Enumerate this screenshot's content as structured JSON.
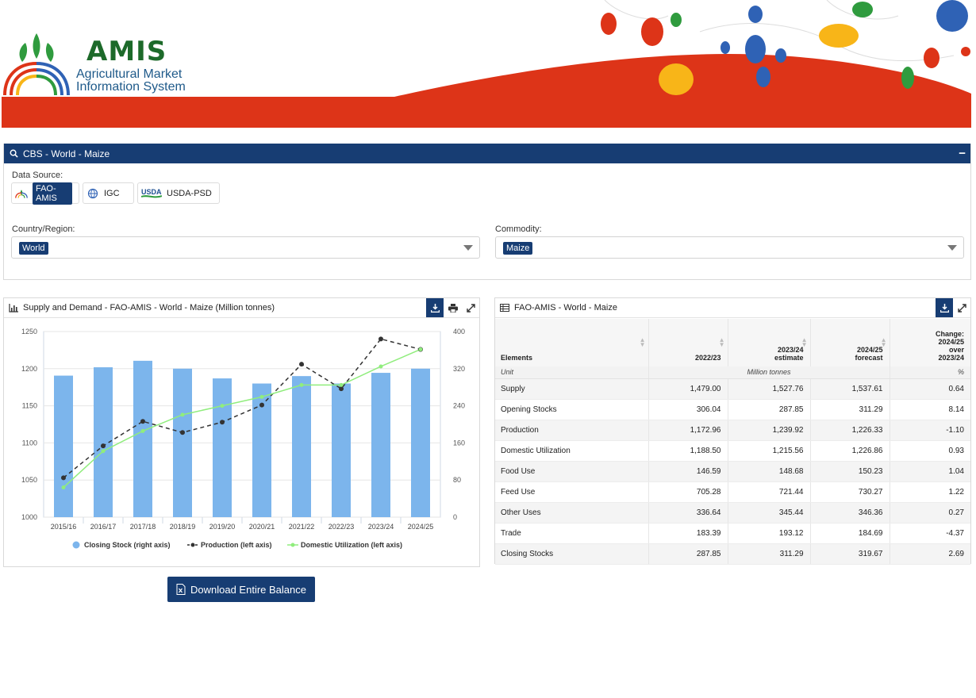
{
  "brand": {
    "name": "AMIS",
    "subtitle_line1": "Agricultural Market",
    "subtitle_line2": "Information System"
  },
  "cbs_panel": {
    "title": "CBS - World - Maize",
    "collapse_icon": "minus-icon",
    "data_source_label": "Data Source:",
    "data_sources": [
      {
        "label": "FAO-AMIS",
        "selected": true
      },
      {
        "label": "IGC",
        "selected": false
      },
      {
        "label": "USDA-PSD",
        "selected": false
      }
    ],
    "country_label": "Country/Region:",
    "country_value": "World",
    "commodity_label": "Commodity:",
    "commodity_value": "Maize"
  },
  "chart_panel": {
    "title": "Supply and Demand - FAO-AMIS - World - Maize (Million tonnes)",
    "tools": [
      "download-icon",
      "print-icon",
      "expand-icon"
    ]
  },
  "chart_data": {
    "type": "bar",
    "categories": [
      "2015/16",
      "2016/17",
      "2017/18",
      "2018/19",
      "2019/20",
      "2020/21",
      "2021/22",
      "2022/23",
      "2023/24",
      "2024/25"
    ],
    "left_axis": {
      "ylim": [
        1000,
        1250
      ],
      "ticks": [
        "1000",
        "1050",
        "1100",
        "1150",
        "1200",
        "1250"
      ]
    },
    "right_axis": {
      "ylim": [
        0,
        400
      ],
      "ticks": [
        "0",
        "80",
        "160",
        "240",
        "320",
        "400"
      ]
    },
    "series": [
      {
        "name": "Closing Stock (right axis)",
        "type": "bar",
        "axis": "right",
        "color": "#7cb5ec",
        "values": [
          305,
          323,
          337,
          320,
          299,
          288,
          304,
          288,
          311,
          320
        ]
      },
      {
        "name": "Production (left axis)",
        "type": "line",
        "style": "dashed",
        "axis": "left",
        "color": "#333333",
        "values": [
          1053,
          1096,
          1129,
          1114,
          1128,
          1151,
          1206,
          1173,
          1240,
          1226
        ]
      },
      {
        "name": "Domestic Utilization (left axis)",
        "type": "line",
        "axis": "left",
        "color": "#90ed7d",
        "values": [
          1040,
          1089,
          1116,
          1138,
          1150,
          1162,
          1178,
          1178,
          1203,
          1226
        ]
      }
    ],
    "legend": "bottom"
  },
  "table_panel": {
    "title": "FAO-AMIS - World - Maize",
    "tools": [
      "download-icon",
      "expand-icon"
    ],
    "headers": [
      {
        "line1": "",
        "line2": "",
        "line3": "Elements"
      },
      {
        "line1": "",
        "line2": "",
        "line3": "2022/23"
      },
      {
        "line1": "",
        "line2": "2023/24",
        "line3": "estimate"
      },
      {
        "line1": "",
        "line2": "2024/25",
        "line3": "forecast"
      },
      {
        "line1": "Change:",
        "line2": "2024/25",
        "line3": "over",
        "line4": "2023/24"
      }
    ],
    "unit_row": {
      "label": "Unit",
      "value": "Million tonnes",
      "pct": "%"
    },
    "rows": [
      {
        "element": "Supply",
        "v1": "1,479.00",
        "v2": "1,527.76",
        "v3": "1,537.61",
        "change": "0.64"
      },
      {
        "element": "Opening Stocks",
        "v1": "306.04",
        "v2": "287.85",
        "v3": "311.29",
        "change": "8.14"
      },
      {
        "element": "Production",
        "v1": "1,172.96",
        "v2": "1,239.92",
        "v3": "1,226.33",
        "change": "-1.10"
      },
      {
        "element": "Domestic Utilization",
        "v1": "1,188.50",
        "v2": "1,215.56",
        "v3": "1,226.86",
        "change": "0.93"
      },
      {
        "element": "Food Use",
        "v1": "146.59",
        "v2": "148.68",
        "v3": "150.23",
        "change": "1.04"
      },
      {
        "element": "Feed Use",
        "v1": "705.28",
        "v2": "721.44",
        "v3": "730.27",
        "change": "1.22"
      },
      {
        "element": "Other Uses",
        "v1": "336.64",
        "v2": "345.44",
        "v3": "346.36",
        "change": "0.27"
      },
      {
        "element": "Trade",
        "v1": "183.39",
        "v2": "193.12",
        "v3": "184.69",
        "change": "-4.37"
      },
      {
        "element": "Closing Stocks",
        "v1": "287.85",
        "v2": "311.29",
        "v3": "319.67",
        "change": "2.69"
      }
    ]
  },
  "download_button": {
    "label": "Download Entire Balance",
    "icon": "excel-file-icon"
  },
  "colors": {
    "navy": "#173d73",
    "banner_red": "#dd3418",
    "bar_blue": "#7cb5ec",
    "line_green": "#90ed7d"
  }
}
